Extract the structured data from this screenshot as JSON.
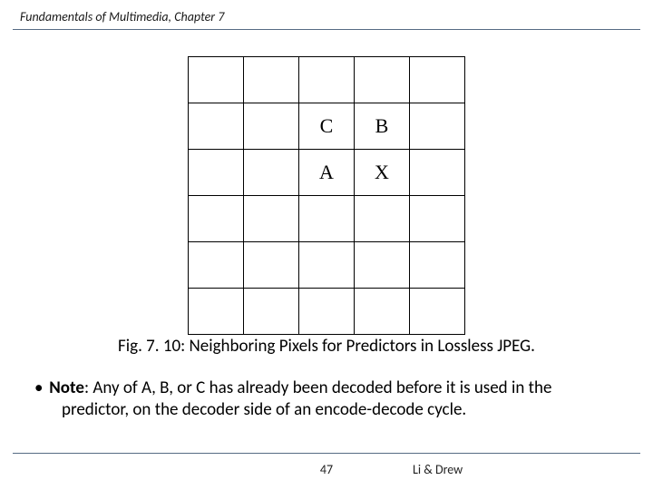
{
  "header": {
    "title": "Fundamentals of Multimedia, Chapter 7"
  },
  "grid": {
    "rows": 6,
    "cols": 5,
    "cells": {
      "r1c2": "C",
      "r1c3": "B",
      "r2c2": "A",
      "r2c3": "X"
    }
  },
  "caption": "Fig. 7. 10: Neighboring Pixels for Predictors in Lossless JPEG.",
  "note": {
    "label": "Note",
    "text_after_label": ": Any of A, B, or C has already been decoded before it is used in the",
    "line2": "predictor, on the decoder side of an encode-decode cycle."
  },
  "footer": {
    "page": "47",
    "authors": "Li & Drew"
  }
}
